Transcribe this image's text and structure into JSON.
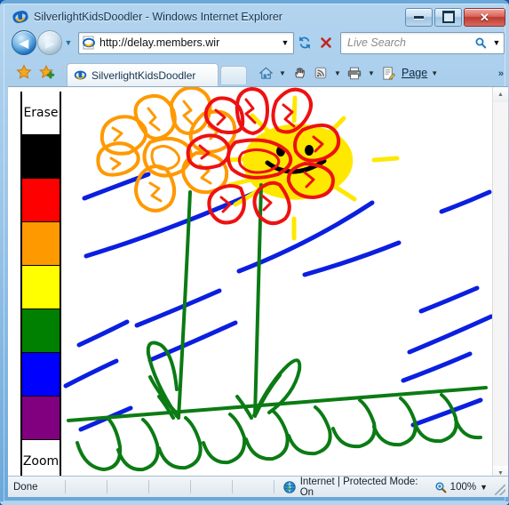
{
  "window": {
    "title": "SilverlightKidsDoodler - Windows Internet Explorer",
    "app_icon": "ie-logo-icon",
    "minimize_label": "Minimize",
    "maximize_label": "Maximize",
    "close_label": "✕"
  },
  "navbar": {
    "back_label": "◀",
    "forward_label": "▶",
    "history_caret": "▼",
    "address": {
      "url": "http://delay.members.wir",
      "dropdown_caret": "▼",
      "favicon": "ie-page-icon"
    },
    "refresh_label": "↯",
    "stop_label": "✕",
    "search": {
      "placeholder": "Live Search",
      "icon": "search-icon",
      "caret": "▼"
    }
  },
  "tabbar": {
    "favorites_center_icon": "star-icon",
    "add_favorite_icon": "star-plus-icon",
    "tabs": [
      {
        "label": "SilverlightKidsDoodler",
        "icon": "ie-page-icon",
        "active": true
      }
    ],
    "new_tab_label": "",
    "tools": [
      {
        "name": "home-icon",
        "caret": "▼"
      },
      {
        "name": "hand-icon",
        "caret": ""
      },
      {
        "name": "rss-icon",
        "caret": "▼"
      },
      {
        "name": "print-icon",
        "caret": "▼"
      },
      {
        "name": "page-icon",
        "caret": "▼"
      }
    ],
    "page_menu_label": "Page",
    "overflow_label": "»"
  },
  "palette": {
    "erase_label": "Erase",
    "zoom_label": "Zoom",
    "colors": [
      {
        "name": "black",
        "hex": "#000000"
      },
      {
        "name": "red",
        "hex": "#FF0000"
      },
      {
        "name": "orange",
        "hex": "#FF9900"
      },
      {
        "name": "yellow",
        "hex": "#FFFF00"
      },
      {
        "name": "green",
        "hex": "#008000"
      },
      {
        "name": "blue",
        "hex": "#0000FF"
      },
      {
        "name": "purple",
        "hex": "#800080"
      }
    ]
  },
  "drawing": {
    "description": "Child's crayon doodle: yellow smiling sun, blue rain streaks, orange and red flowers with green stems and leaves, green grass line",
    "stroke_colors": {
      "rain": "#0000EE",
      "sun": "#FFEE00",
      "sun_face": "#000000",
      "flower_orange": "#FF9900",
      "flower_red": "#EE1111",
      "grass": "#0B7B14"
    }
  },
  "scrollbar": {
    "up_arrow": "▲",
    "down_arrow": "▼"
  },
  "statusbar": {
    "status": "Done",
    "zone": "Internet | Protected Mode: On",
    "zone_icon": "globe-icon",
    "zoom_level": "100%",
    "zoom_icon": "zoom-icon",
    "zoom_caret": "▼"
  }
}
